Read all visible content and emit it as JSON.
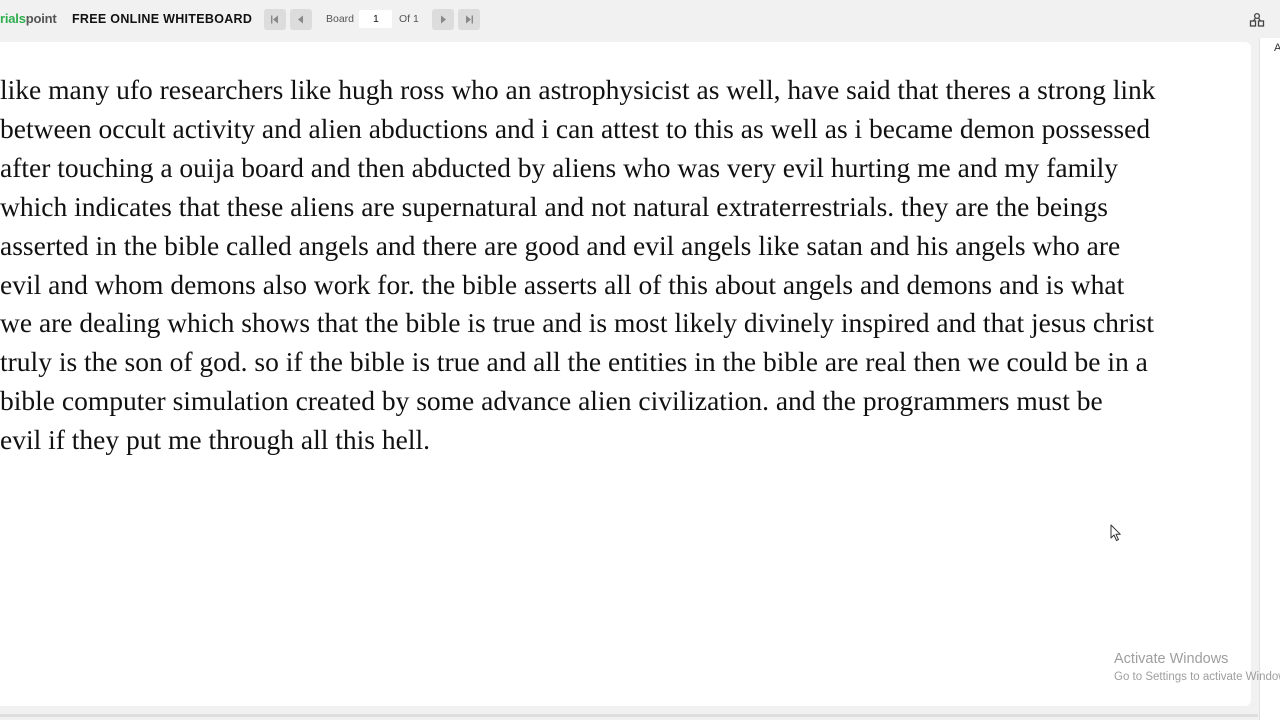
{
  "header": {
    "logo_part1": "rials",
    "logo_part2": "point",
    "title": "FREE ONLINE WHITEBOARD",
    "board_label": "Board",
    "board_number": "1",
    "of_label": "Of 1",
    "icons": {
      "first": "first-page-icon",
      "prev": "previous-page-icon",
      "next": "next-page-icon",
      "last": "last-page-icon",
      "share": "share-icon"
    }
  },
  "board": {
    "lines": [
      "like many ufo researchers like hugh ross who an astrophysicist as well, have said that theres a strong link",
      "between occult activity and alien abductions and i can attest to this as well as i became demon possessed",
      "after touching a ouija board and then abducted by aliens who was very evil hurting me and my family",
      "which indicates that these aliens are supernatural and not natural extraterrestrials. they are the beings",
      "asserted in the bible called angels and there are good and evil angels like satan and his angels who are",
      "evil and whom demons also work for. the bible asserts all of this about angels and demons and is what",
      "we are dealing which shows that the bible is true and is most likely divinely inspired and that jesus christ",
      "truly is the son of god. so if the bible is true and all the entities in the bible are real then we could be in a",
      "bible computer simulation created by some advance alien civilization. and the programmers must be",
      "evil if they put me through all this hell."
    ]
  },
  "right_panel": {
    "letter": "A"
  },
  "watermark": {
    "title": "Activate Windows",
    "subtitle": "Go to Settings to activate Windows."
  },
  "colors": {
    "logo_green": "#2fae4f",
    "background": "#f1f1f1",
    "canvas": "#ffffff"
  }
}
